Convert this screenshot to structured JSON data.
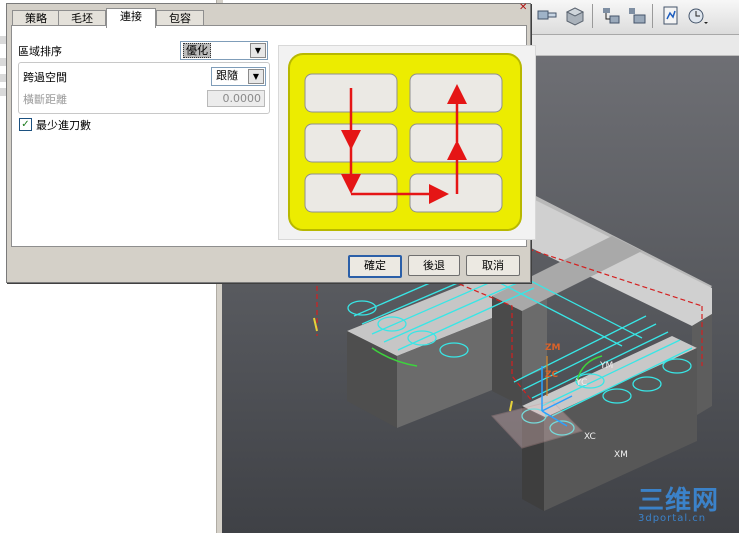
{
  "dialog": {
    "tabs": [
      {
        "label": "策略"
      },
      {
        "label": "毛坯"
      },
      {
        "label": "連接"
      },
      {
        "label": "包容"
      }
    ],
    "active_tab": "連接",
    "region_sequence": {
      "label": "區域排序",
      "value": "優化"
    },
    "cross_voids": {
      "label": "跨過空間",
      "value": "跟隨"
    },
    "step_distance": {
      "label": "橫斷距離",
      "value": "0.0000"
    },
    "min_engagement": {
      "label": "最少進刀數",
      "checked": true
    },
    "buttons": {
      "ok": "確定",
      "back": "後退",
      "cancel": "取消"
    }
  },
  "viewport": {
    "labels": {
      "zm": "ZM",
      "zc": "ZC",
      "ym": "YM",
      "yc": "YC",
      "xc": "XC",
      "xm": "XM"
    },
    "watermark": {
      "title": "三维网",
      "url": "3dportal.cn"
    }
  },
  "colors": {
    "preview_yellow": "#ecec00",
    "arrow_red": "#e51515",
    "toolpath_cyan": "#38e6e6",
    "path_green": "#3dd33d",
    "default_button_border": "#2b5fa8"
  }
}
